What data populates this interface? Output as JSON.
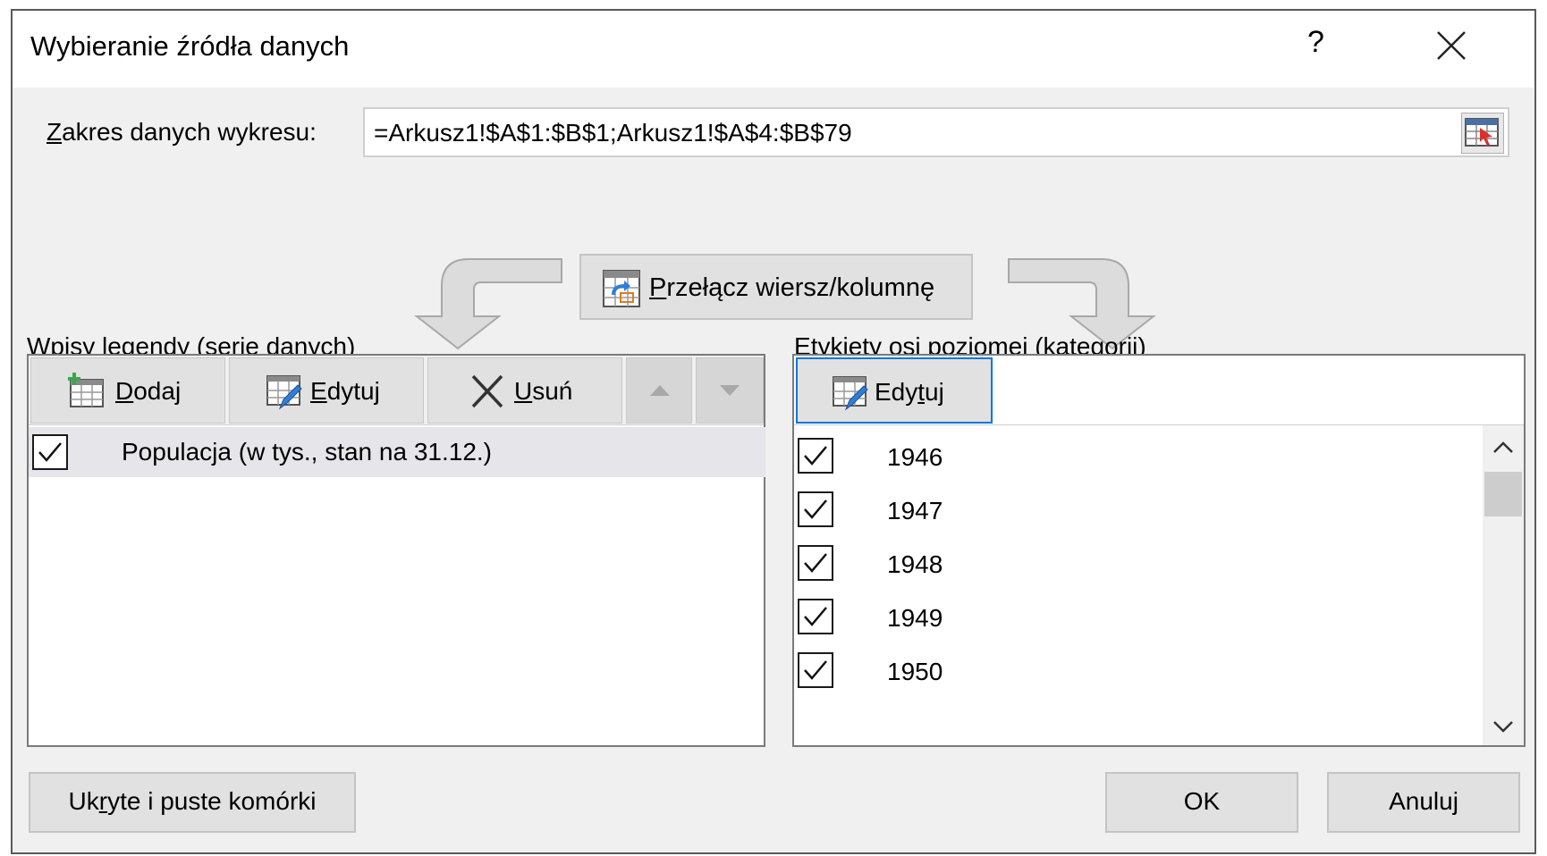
{
  "dialog": {
    "title": "Wybieranie źródła danych",
    "help_label": "?",
    "close_icon": "close-icon"
  },
  "range": {
    "label_underline": "Z",
    "label_rest": "akres danych wykresu:",
    "value": "=Arkusz1!$A$1:$B$1;Arkusz1!$A$4:$B$79",
    "picker_icon": "range-picker-icon"
  },
  "switch": {
    "label_underline": "P",
    "label_rest": "rzełącz wiersz/kolumnę",
    "icon": "switch-row-column-icon"
  },
  "legend": {
    "label_pre": "Wpisy legendy (",
    "label_underline": "s",
    "label_post": "erie danych)",
    "add": {
      "u": "D",
      "rest": "odaj"
    },
    "edit": {
      "u": "E",
      "rest": "dytuj"
    },
    "remove": {
      "u": "U",
      "rest": "suń"
    },
    "series": [
      {
        "label": "Populacja (w tys., stan na 31.12.)",
        "checked": true
      }
    ]
  },
  "categories": {
    "label_pre": "E",
    "label_underline": "t",
    "label_post": "ykiety osi poziomej (kategorii)",
    "edit": {
      "pre": "Edy",
      "u": "t",
      "post": "uj"
    },
    "items": [
      {
        "label": "1946",
        "checked": true
      },
      {
        "label": "1947",
        "checked": true
      },
      {
        "label": "1948",
        "checked": true
      },
      {
        "label": "1949",
        "checked": true
      },
      {
        "label": "1950",
        "checked": true
      }
    ]
  },
  "footer": {
    "hidden_cells": {
      "pre": "Uk",
      "u": "r",
      "post": "yte i puste komórki"
    },
    "ok": "OK",
    "cancel": "Anuluj"
  },
  "colors": {
    "dialog_bg": "#f0f0f0",
    "button_bg": "#e1e1e1",
    "focus_border": "#0078d7",
    "selected_row": "#e5e5ea"
  }
}
